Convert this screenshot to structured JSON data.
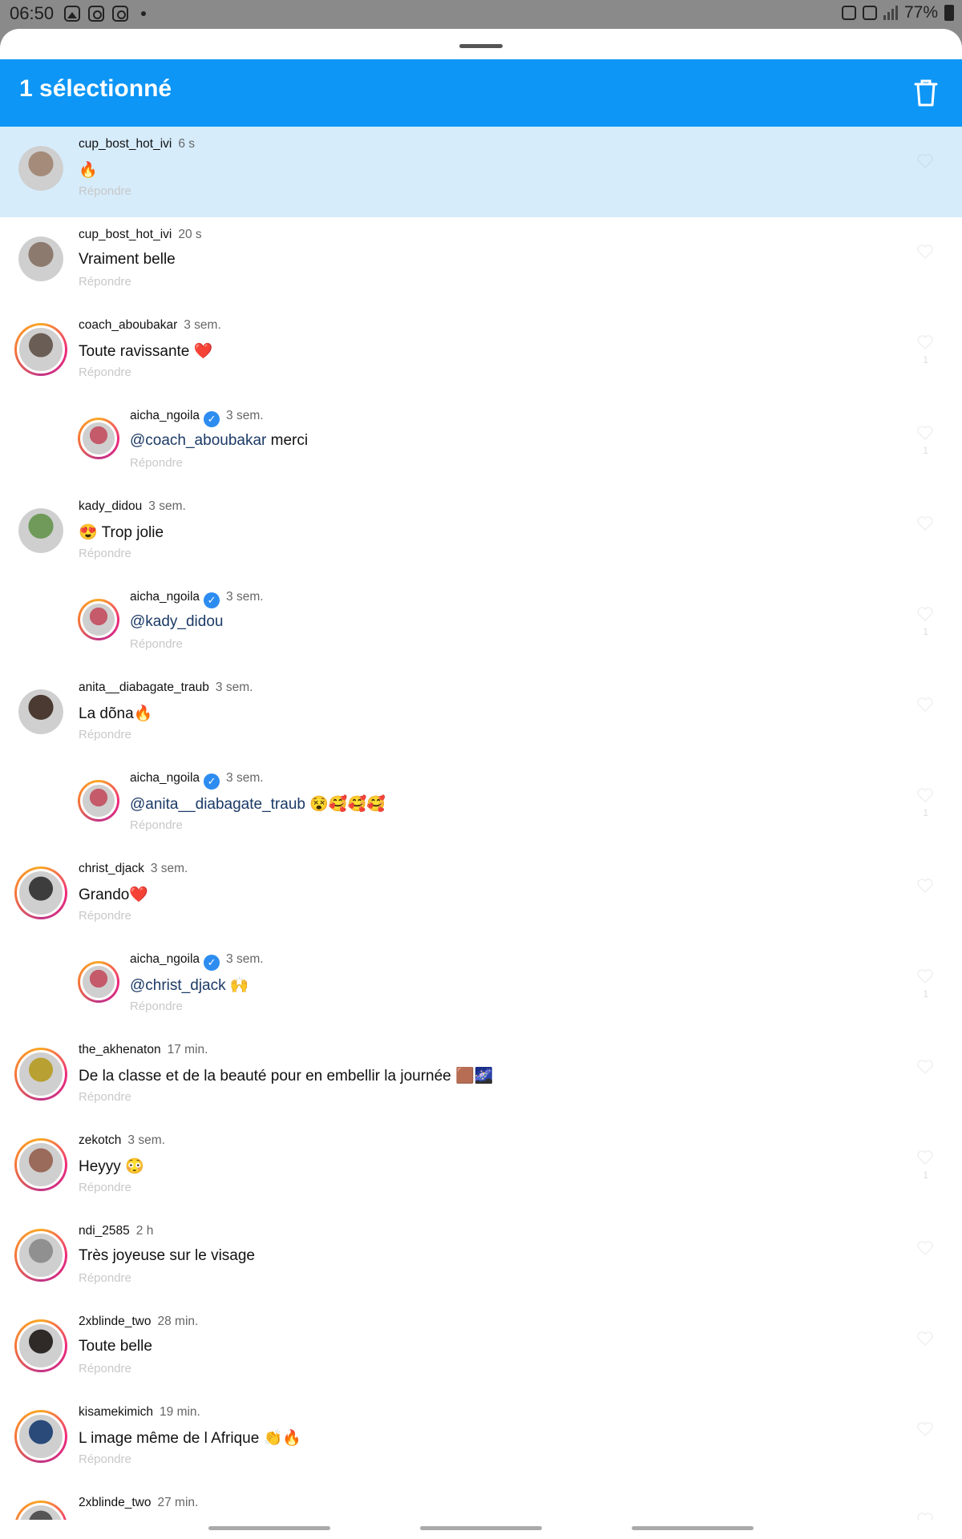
{
  "status_bar": {
    "time": "06:50",
    "battery": "77%"
  },
  "header": {
    "title": "1 sélectionné"
  },
  "colors": {
    "accent": "#0d96f6",
    "selected_row": "#d6ecfb",
    "mention": "#1b3a66"
  },
  "reply_label": "Répondre",
  "comments": [
    {
      "user": "cup_bost_hot_ivi",
      "time": "6 s",
      "text": "🔥",
      "mention": ""
    },
    {
      "user": "cup_bost_hot_ivi",
      "time": "20 s",
      "text": "Vraiment belle",
      "mention": ""
    },
    {
      "user": "coach_aboubakar",
      "time": "3 sem.",
      "text": "Toute ravissante ❤️",
      "mention": "",
      "likes": "1"
    },
    {
      "user": "aicha_ngoila",
      "time": "3 sem.",
      "mention": "@coach_aboubakar",
      "text": " merci",
      "likes": "1"
    },
    {
      "user": "kady_didou",
      "time": "3 sem.",
      "text": "😍 Trop jolie",
      "mention": ""
    },
    {
      "user": "aicha_ngoila",
      "time": "3 sem.",
      "mention": "@kady_didou",
      "text": "",
      "likes": "1"
    },
    {
      "user": "anita__diabagate_traub",
      "time": "3 sem.",
      "text": "La dõna🔥",
      "mention": ""
    },
    {
      "user": "aicha_ngoila",
      "time": "3 sem.",
      "mention": "@anita__diabagate_traub",
      "text": " 😵🥰🥰🥰",
      "likes": "1"
    },
    {
      "user": "christ_djack",
      "time": "3 sem.",
      "text": "Grando❤️",
      "mention": ""
    },
    {
      "user": "aicha_ngoila",
      "time": "3 sem.",
      "mention": "@christ_djack",
      "text": " 🙌",
      "likes": "1"
    },
    {
      "user": "the_akhenaton",
      "time": "17 min.",
      "text": "De la classe et de la beauté pour en embellir la journée      🟫🌌",
      "mention": ""
    },
    {
      "user": "zekotch",
      "time": "3 sem.",
      "text": "Heyyy 😳",
      "mention": "",
      "likes": "1"
    },
    {
      "user": "ndi_2585",
      "time": "2 h",
      "text": "Très joyeuse sur le visage",
      "mention": ""
    },
    {
      "user": "2xblinde_two",
      "time": "28 min.",
      "text": "Toute belle",
      "mention": ""
    },
    {
      "user": "kisamekimich",
      "time": "19 min.",
      "text": "L image même de l Afrique 👏🔥",
      "mention": ""
    },
    {
      "user": "2xblinde_two",
      "time": "27 min.",
      "text": "",
      "mention": ""
    }
  ]
}
